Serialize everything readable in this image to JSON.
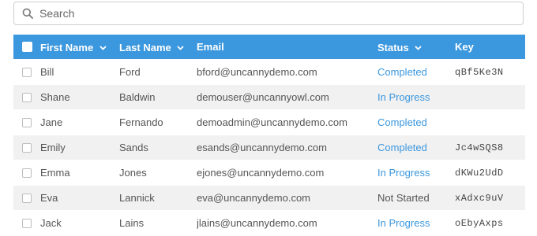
{
  "search": {
    "placeholder": "Search"
  },
  "table": {
    "headers": {
      "first_name": "First Name",
      "last_name": "Last Name",
      "email": "Email",
      "status": "Status",
      "key": "Key"
    },
    "rows": [
      {
        "first": "Bill",
        "last": "Ford",
        "email": "bford@uncannydemo.com",
        "status": "Completed",
        "key": "qBf5Ke3N"
      },
      {
        "first": "Shane",
        "last": "Baldwin",
        "email": "demouser@uncannyowl.com",
        "status": "In Progress",
        "key": ""
      },
      {
        "first": "Jane",
        "last": "Fernando",
        "email": "demoadmin@uncannydemo.com",
        "status": "Completed",
        "key": ""
      },
      {
        "first": "Emily",
        "last": "Sands",
        "email": "esands@uncannydemo.com",
        "status": "Completed",
        "key": "Jc4wSQS8"
      },
      {
        "first": "Emma",
        "last": "Jones",
        "email": "ejones@uncannydemo.com",
        "status": "In Progress",
        "key": "dKWu2UdD"
      },
      {
        "first": "Eva",
        "last": "Lannick",
        "email": "eva@uncannydemo.com",
        "status": "Not Started",
        "key": "xAdxc9uV"
      },
      {
        "first": "Jack",
        "last": "Lains",
        "email": "jlains@uncannydemo.com",
        "status": "In Progress",
        "key": "oEbyAxps"
      }
    ]
  },
  "colors": {
    "header_bg": "#3b97de",
    "link": "#3b97de",
    "stripe": "#f1f1f1"
  }
}
